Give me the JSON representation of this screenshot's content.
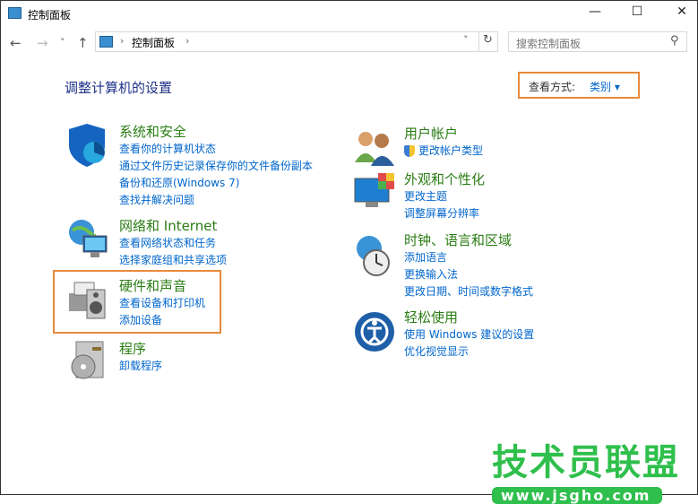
{
  "window": {
    "title": "控制面板",
    "minimize": "—",
    "maximize": "☐",
    "close": "✕"
  },
  "nav": {
    "back": "←",
    "forward": "→",
    "recent": "˅",
    "up": "↑"
  },
  "address": {
    "sep": "›",
    "crumb": "控制面板",
    "sep2": "›",
    "dropdown": "˅",
    "refresh": "↻"
  },
  "search": {
    "placeholder": "搜索控制面板",
    "icon": "⚲"
  },
  "page_title": "调整计算机的设置",
  "view_by": {
    "label": "查看方式:",
    "value": "类别 ▾"
  },
  "left": [
    {
      "title": "系统和安全",
      "links": [
        "查看你的计算机状态",
        "通过文件历史记录保存你的文件备份副本",
        "备份和还原(Windows 7)",
        "查找并解决问题"
      ]
    },
    {
      "title": "网络和 Internet",
      "links": [
        "查看网络状态和任务",
        "选择家庭组和共享选项"
      ]
    },
    {
      "title": "硬件和声音",
      "links": [
        "查看设备和打印机",
        "添加设备"
      ]
    },
    {
      "title": "程序",
      "links": [
        "卸载程序"
      ]
    }
  ],
  "right": [
    {
      "title": "用户帐户",
      "links": [
        "更改帐户类型"
      ]
    },
    {
      "title": "外观和个性化",
      "links": [
        "更改主题",
        "调整屏幕分辨率"
      ]
    },
    {
      "title": "时钟、语言和区域",
      "links": [
        "添加语言",
        "更换输入法",
        "更改日期、时间或数字格式"
      ]
    },
    {
      "title": "轻松使用",
      "links": [
        "使用 Windows 建议的设置",
        "优化视觉显示"
      ]
    }
  ],
  "watermark": {
    "name": "技术员联盟",
    "url": "www.jsgho.com"
  }
}
